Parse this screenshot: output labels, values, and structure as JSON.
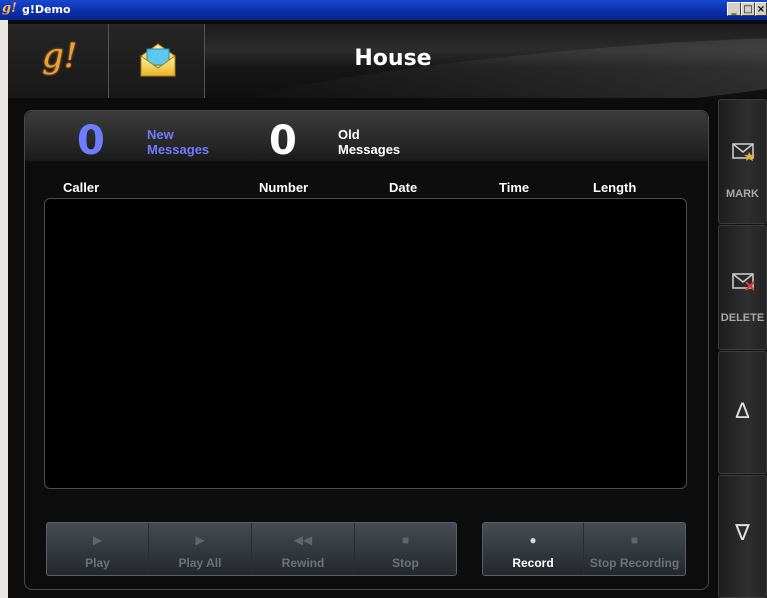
{
  "window": {
    "title": "g!Demo",
    "icon": "g-app-icon"
  },
  "header": {
    "logo_text": "g!",
    "title": "House",
    "mail_icon": "envelope-icon"
  },
  "counts": {
    "new_count": "0",
    "new_label_1": "New",
    "new_label_2": "Messages",
    "old_count": "0",
    "old_label_1": "Old",
    "old_label_2": "Messages",
    "new_color": "#6f7cff"
  },
  "columns": [
    "Caller",
    "Number",
    "Date",
    "Time",
    "Length"
  ],
  "messages": [],
  "playback": [
    {
      "label": "Play",
      "icon": "play-icon",
      "glyph": "▶"
    },
    {
      "label": "Play All",
      "icon": "play-all-icon",
      "glyph": "▶"
    },
    {
      "label": "Rewind",
      "icon": "rewind-icon",
      "glyph": "◀◀"
    },
    {
      "label": "Stop",
      "icon": "stop-icon",
      "glyph": "■"
    }
  ],
  "recording": [
    {
      "label": "Record",
      "icon": "record-icon",
      "glyph": "●"
    },
    {
      "label": "Stop Recording",
      "icon": "stop-recording-icon",
      "glyph": "■"
    }
  ],
  "sidebar": {
    "mark_label": "MARK",
    "mark_icon": "mark-envelope-icon",
    "delete_label": "DELETE",
    "delete_icon": "delete-envelope-icon",
    "up_glyph": "Δ",
    "down_glyph": "∇"
  }
}
